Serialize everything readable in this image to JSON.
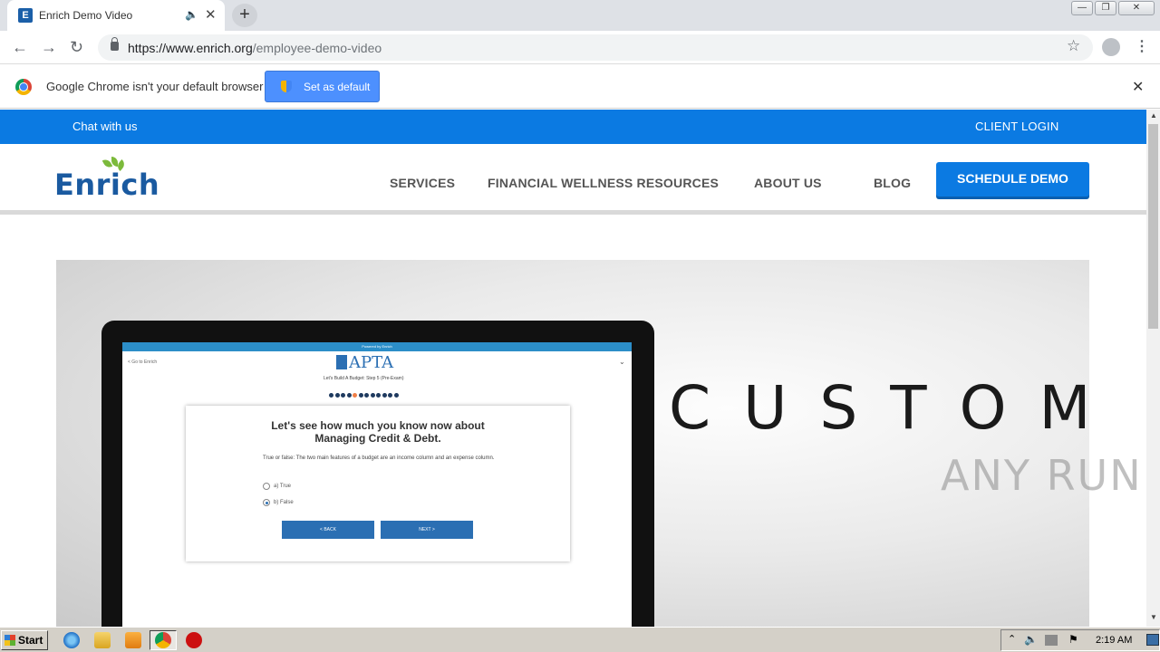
{
  "browser": {
    "tab_title": "Enrich Demo Video",
    "tab_favicon": "E",
    "url_host": "https://www.enrich.org",
    "url_path": "/employee-demo-video",
    "infobar_text": "Google Chrome isn't your default browser",
    "set_default_label": "Set as default"
  },
  "site": {
    "chat_link": "Chat with us",
    "client_login": "CLIENT LOGIN",
    "logo_text": "Enrich",
    "nav": [
      "SERVICES",
      "FINANCIAL WELLNESS RESOURCES",
      "ABOUT US",
      "BLOG"
    ],
    "cta": "SCHEDULE DEMO"
  },
  "video": {
    "screen_header": "Powered by Enrich",
    "go_back": "< Go to Enrich",
    "apta": "APTA",
    "budget_step": "Let's Build A Budget: Step 5 (Pre-Exam)",
    "dot_count": 12,
    "active_dot": 5,
    "quiz_heading_line1": "Let's see how much you know now about",
    "quiz_heading_line2": "Managing Credit & Debt.",
    "question": "True or false: The two main features of a budget are an income column and an expense column.",
    "option_a": "a) True",
    "option_b": "b) False",
    "selected_option": "b",
    "back_btn": "< BACK",
    "next_btn": "NEXT >",
    "overlay_word": "CUSTOM"
  },
  "watermark": "ANY RUN",
  "taskbar": {
    "start": "Start",
    "clock": "2:19 AM"
  },
  "colors": {
    "brand_blue": "#0b7ae2",
    "logo_blue": "#1a5aa0",
    "leaf_green": "#7cba3b"
  }
}
